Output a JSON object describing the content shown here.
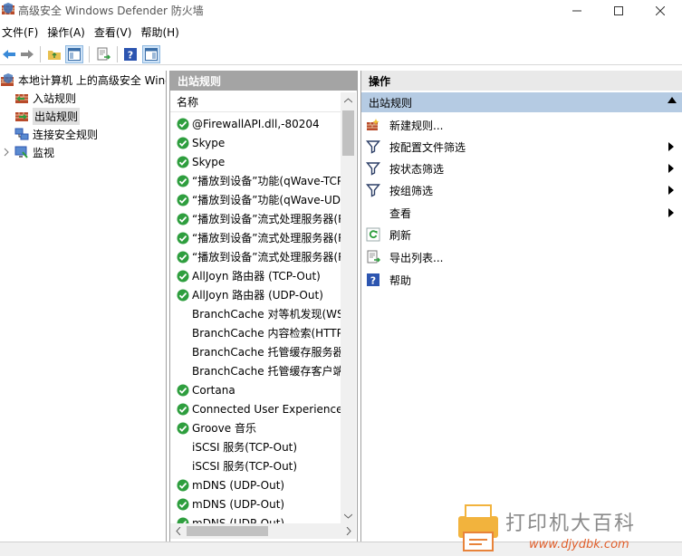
{
  "window": {
    "title": "高级安全 Windows Defender 防火墙"
  },
  "menu": [
    "文件(F)",
    "操作(A)",
    "查看(V)",
    "帮助(H)"
  ],
  "tree": {
    "root": "本地计算机 上的高级安全 Windo",
    "items": [
      "入站规则",
      "出站规则",
      "连接安全规则",
      "监视"
    ]
  },
  "middle": {
    "header": "出站规则",
    "column": "名称",
    "rows": [
      {
        "name": "@FirewallAPI.dll,-80204",
        "enabled": true
      },
      {
        "name": "Skype",
        "enabled": true
      },
      {
        "name": "Skype",
        "enabled": true
      },
      {
        "name": "“播放到设备”功能(qWave-TCP",
        "enabled": true
      },
      {
        "name": "“播放到设备”功能(qWave-UDF",
        "enabled": true
      },
      {
        "name": "“播放到设备”流式处理服务器(R",
        "enabled": true
      },
      {
        "name": "“播放到设备”流式处理服务器(R",
        "enabled": true
      },
      {
        "name": "“播放到设备”流式处理服务器(R",
        "enabled": true
      },
      {
        "name": "AllJoyn 路由器 (TCP-Out)",
        "enabled": true
      },
      {
        "name": "AllJoyn 路由器 (UDP-Out)",
        "enabled": true
      },
      {
        "name": "BranchCache 对等机发现(WSI",
        "enabled": false
      },
      {
        "name": "BranchCache 内容检索(HTTP-",
        "enabled": false
      },
      {
        "name": "BranchCache 托管缓存服务器",
        "enabled": false
      },
      {
        "name": "BranchCache 托管缓存客户端",
        "enabled": false
      },
      {
        "name": "Cortana",
        "enabled": true
      },
      {
        "name": "Connected User Experiences",
        "enabled": true
      },
      {
        "name": "Groove 音乐",
        "enabled": true
      },
      {
        "name": "iSCSI 服务(TCP-Out)",
        "enabled": false
      },
      {
        "name": "iSCSI 服务(TCP-Out)",
        "enabled": false
      },
      {
        "name": "mDNS (UDP-Out)",
        "enabled": true
      },
      {
        "name": "mDNS (UDP-Out)",
        "enabled": true
      },
      {
        "name": "mDNS (UDP-Out)",
        "enabled": true
      }
    ]
  },
  "actions": {
    "header": "操作",
    "group": "出站规则",
    "items": [
      {
        "label": "新建规则...",
        "submenu": false,
        "icon": "new-rule-icon"
      },
      {
        "label": "按配置文件筛选",
        "submenu": true,
        "icon": "filter-icon"
      },
      {
        "label": "按状态筛选",
        "submenu": true,
        "icon": "filter-icon"
      },
      {
        "label": "按组筛选",
        "submenu": true,
        "icon": "filter-icon"
      },
      {
        "label": "查看",
        "submenu": true,
        "icon": ""
      },
      {
        "label": "刷新",
        "submenu": false,
        "icon": "refresh-icon"
      },
      {
        "label": "导出列表...",
        "submenu": false,
        "icon": "export-icon"
      },
      {
        "label": "帮助",
        "submenu": false,
        "icon": "help-icon"
      }
    ]
  },
  "watermark": {
    "text": "打印机大百科",
    "url": "www.djydbk.com"
  },
  "colors": {
    "check_green": "#2e9e3e",
    "action_group_bg": "#b5cbe3",
    "middle_header_bg": "#a4a4a4"
  }
}
